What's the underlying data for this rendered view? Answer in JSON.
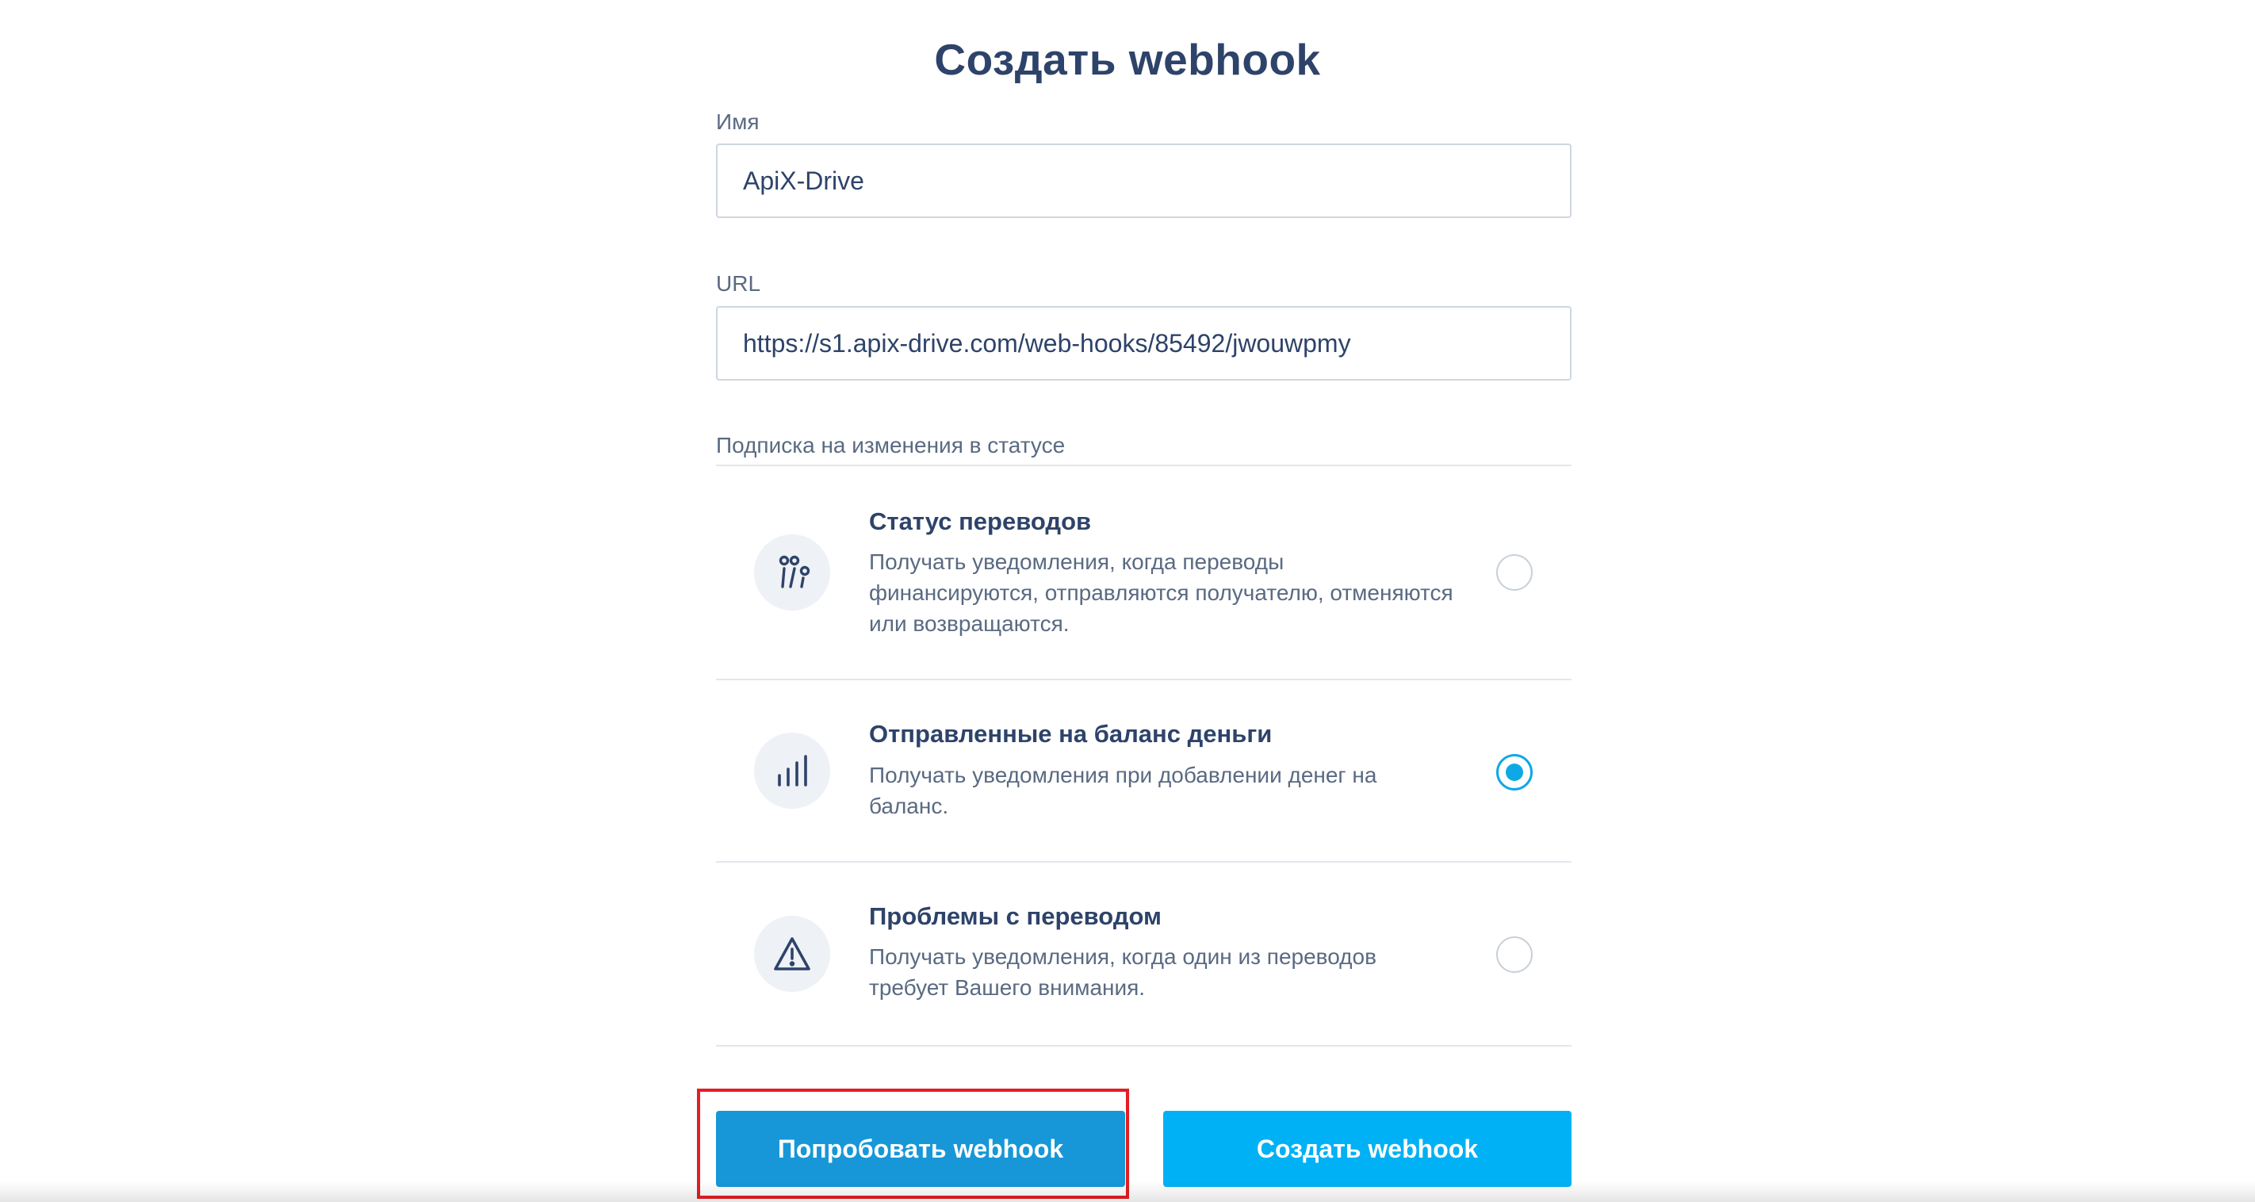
{
  "page": {
    "title": "Создать webhook"
  },
  "form": {
    "name": {
      "label": "Имя",
      "value": "ApiX-Drive"
    },
    "url": {
      "label": "URL",
      "value": "https://s1.apix-drive.com/web-hooks/85492/jwouwpmy"
    },
    "subscription_label": "Подписка на изменения в статусе",
    "options": [
      {
        "title": "Статус переводов",
        "description": "Получать уведомления, когда переводы финансируются, отправляются получателю, отменяются или возвращаются.",
        "icon": "transfer-status-icon",
        "selected": false
      },
      {
        "title": "Отправленные на баланс деньги",
        "description": "Получать уведомления при добавлении денег на баланс.",
        "icon": "bar-chart-icon",
        "selected": true
      },
      {
        "title": "Проблемы с переводом",
        "description": "Получать уведомления, когда один из переводов требует Вашего внимания.",
        "icon": "warning-triangle-icon",
        "selected": false
      }
    ]
  },
  "buttons": {
    "try_label": "Попробовать webhook",
    "create_label": "Создать webhook"
  },
  "colors": {
    "title": "#2e4369",
    "accent": "#00b1f5",
    "try_button": "#1797d8",
    "highlight": "#e31e24"
  }
}
